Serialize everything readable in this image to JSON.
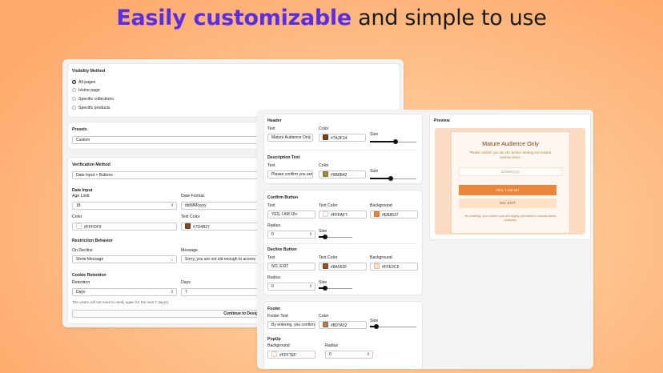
{
  "headline": {
    "accent": "Easily customizable",
    "rest": " and simple to use"
  },
  "left": {
    "visibility": {
      "title": "Visibility Method",
      "options": [
        {
          "label": "All pages",
          "selected": true
        },
        {
          "label": "Home page",
          "selected": false
        },
        {
          "label": "Specific collections",
          "selected": false
        },
        {
          "label": "Specific products",
          "selected": false
        }
      ]
    },
    "presets": {
      "title": "Presets",
      "value": "Custom"
    },
    "verification": {
      "title": "Verification Method",
      "method_value": "Date Input + Buttons",
      "date_input_title": "Date Input",
      "age_limit_label": "Age Limit",
      "age_limit_value": "18",
      "date_format_label": "Date Format",
      "date_format_value": "dd/MM/yyyy",
      "color_label": "Color",
      "color_value": "#FFFDF9",
      "text_color_label": "Text Color",
      "text_color_value": "#7D4B27",
      "restriction_title": "Restriction Behavior",
      "on_decline_label": "On Decline",
      "on_decline_value": "Show Message",
      "message_label": "Message",
      "message_value": "Sorry, you are not old enough to access",
      "cookie_title": "Cookie Retention",
      "retention_label": "Retention",
      "retention_value": "Days",
      "days_label": "Days",
      "days_value": "7",
      "note": "The visitor will not need to verify again for the next 7 day(s).",
      "continue_label": "Continue to Design Tab"
    }
  },
  "design": {
    "header": {
      "title": "Header",
      "text_label": "Text",
      "text_value": "Mature Audience Only",
      "color_label": "Color",
      "color_value": "#7A3F14",
      "size_label": "Size",
      "size_fraction": 0.55
    },
    "description": {
      "title": "Description Text",
      "text_label": "Text",
      "text_value": "Please confirm you are",
      "color_label": "Color",
      "color_value": "#9B8B42",
      "size_label": "Size",
      "size_fraction": 0.45
    },
    "confirm": {
      "title": "Confirm Button",
      "text_label": "Text",
      "text_value": "YES, I AM 18+",
      "text_color_label": "Text Color",
      "text_color_value": "#FFFAF7",
      "bg_label": "Background",
      "bg_value": "#EB8537",
      "radius_label": "Radius",
      "radius_value": "0",
      "size_label": "Size",
      "size_fraction": 0.15
    },
    "decline": {
      "title": "Decline Button",
      "text_label": "Text",
      "text_value": "NO, EXIT",
      "text_color_label": "Text Color",
      "text_color_value": "#8A552F",
      "bg_label": "Background",
      "bg_value": "#FFE2C5",
      "radius_label": "Radius",
      "radius_value": "0",
      "size_label": "Size",
      "size_fraction": 0.15
    },
    "footer": {
      "title": "Footer",
      "text_label": "Footer Text",
      "text_value": "By entering, you confirm",
      "color_label": "Color",
      "color_value": "#B07A52",
      "size_label": "Size",
      "size_fraction": 0.1
    },
    "popup": {
      "title": "PopUp",
      "bg_label": "Background",
      "bg_value": "#FFF7EF",
      "radius_label": "Radius",
      "radius_value": "0"
    }
  },
  "preview": {
    "title": "Preview",
    "outer_bg": "#FBDCC2",
    "popup_bg": "#FFF7EF",
    "heading": "Mature Audience Only",
    "description": "Please confirm you are 18+ before viewing our curated reserve items.",
    "date_placeholder": "dd/MM/yyyy",
    "confirm_label": "YES, I AM 18+",
    "decline_label": "NO, EXIT",
    "footer": "By entering, you confirm you are legally permitted to access these products."
  }
}
